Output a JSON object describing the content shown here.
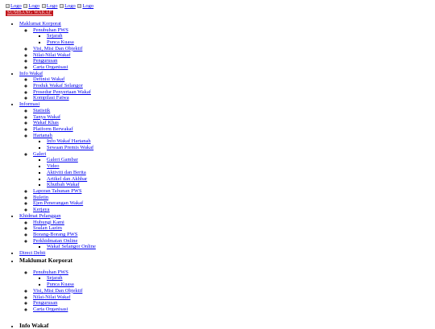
{
  "header": {
    "logo_alts": [
      "Logo",
      "Logo",
      "Logo",
      "Logo",
      "Logo"
    ],
    "cta_label": "SUMBANG WAKAF",
    "cta_color": "#c0141a"
  },
  "menu": [
    {
      "label": "Maklumat Korporat",
      "children": [
        {
          "label": "Penubuhan PWS",
          "children": [
            {
              "label": "Sejarah"
            },
            {
              "label": "Punca Kuasa"
            }
          ]
        },
        {
          "label": "Visi, Misi Dan Objektif"
        },
        {
          "label": "Nilai-Nilai Wakaf"
        },
        {
          "label": "Pengurusan"
        },
        {
          "label": "Carta Organisasi"
        }
      ]
    },
    {
      "label": "Info Wakaf",
      "children": [
        {
          "label": "Definisi Wakaf"
        },
        {
          "label": "Produk Wakaf Selangor"
        },
        {
          "label": "Prosedur Penyertaan Wakaf"
        },
        {
          "label": "Kompilasi Fatwa"
        }
      ]
    },
    {
      "label": "Informasi",
      "children": [
        {
          "label": "Statistik"
        },
        {
          "label": "Tanya Wakaf"
        },
        {
          "label": "Wakaf Khas"
        },
        {
          "label": "Platform Berwakaf"
        },
        {
          "label": "Hartanah",
          "children": [
            {
              "label": "Info Wakaf Hartanah"
            },
            {
              "label": "Sewaan Premis Wakaf"
            }
          ]
        },
        {
          "label": "Galeri",
          "children": [
            {
              "label": "Galeri Gambar"
            },
            {
              "label": "Video"
            },
            {
              "label": "Aktiviti dan Berita"
            },
            {
              "label": "Artikel dan Akhbar"
            },
            {
              "label": "Khutbah Wakaf"
            }
          ]
        },
        {
          "label": "Laporan Tahunan PWS"
        },
        {
          "label": "Buletin"
        },
        {
          "label": "Ejen Penerangan Wakaf"
        },
        {
          "label": "Kerjaya"
        }
      ]
    },
    {
      "label": "Khidmat Pelanggan",
      "children": [
        {
          "label": "Hubungi Kami"
        },
        {
          "label": "Soalan Lazim"
        },
        {
          "label": "Borang-Borang PWS"
        },
        {
          "label": "Perkhidmatan Online",
          "children": [
            {
              "label": "Wakaf Selangor Online"
            }
          ]
        }
      ]
    },
    {
      "label": "Direct Debit"
    }
  ],
  "section": {
    "heading": "Maklumat Korporat",
    "items": [
      {
        "label": "Penubuhan PWS",
        "children": [
          {
            "label": "Sejarah"
          },
          {
            "label": "Punca Kuasa"
          }
        ]
      },
      {
        "label": "Visi, Misi Dan Objektif"
      },
      {
        "label": "Nilai-Nilai Wakaf"
      },
      {
        "label": "Pengurusan"
      },
      {
        "label": "Carta Organisasi"
      }
    ],
    "next_heading": "Info Wakaf"
  }
}
